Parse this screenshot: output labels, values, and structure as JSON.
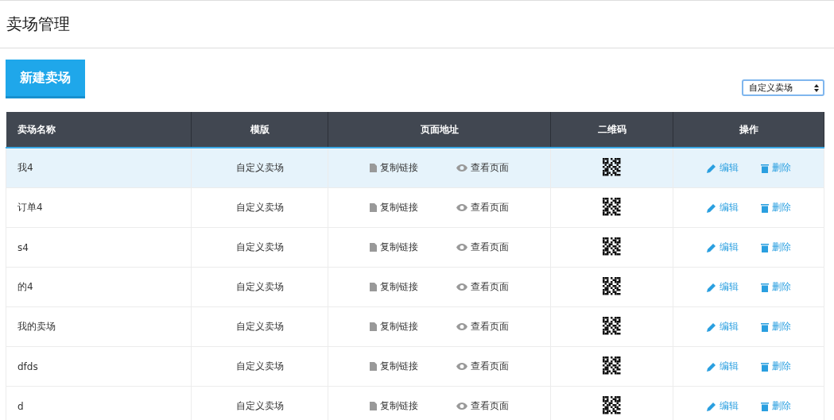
{
  "page_title": "卖场管理",
  "new_button": "新建卖场",
  "filter_select": {
    "value": "自定义卖场"
  },
  "table": {
    "columns": [
      "卖场名称",
      "模版",
      "页面地址",
      "二维码",
      "操作"
    ],
    "rows": [
      {
        "name": "我4",
        "template": "自定义卖场",
        "copy_link": "复制链接",
        "view_page": "查看页面",
        "edit": "编辑",
        "delete": "删除",
        "selected": true
      },
      {
        "name": "订单4",
        "template": "自定义卖场",
        "copy_link": "复制链接",
        "view_page": "查看页面",
        "edit": "编辑",
        "delete": "删除",
        "selected": false
      },
      {
        "name": "s4",
        "template": "自定义卖场",
        "copy_link": "复制链接",
        "view_page": "查看页面",
        "edit": "编辑",
        "delete": "删除",
        "selected": false
      },
      {
        "name": "的4",
        "template": "自定义卖场",
        "copy_link": "复制链接",
        "view_page": "查看页面",
        "edit": "编辑",
        "delete": "删除",
        "selected": false
      },
      {
        "name": "我的卖场",
        "template": "自定义卖场",
        "copy_link": "复制链接",
        "view_page": "查看页面",
        "edit": "编辑",
        "delete": "删除",
        "selected": false
      },
      {
        "name": "dfds",
        "template": "自定义卖场",
        "copy_link": "复制链接",
        "view_page": "查看页面",
        "edit": "编辑",
        "delete": "删除",
        "selected": false
      },
      {
        "name": "d",
        "template": "自定义卖场",
        "copy_link": "复制链接",
        "view_page": "查看页面",
        "edit": "编辑",
        "delete": "删除",
        "selected": false
      }
    ]
  }
}
